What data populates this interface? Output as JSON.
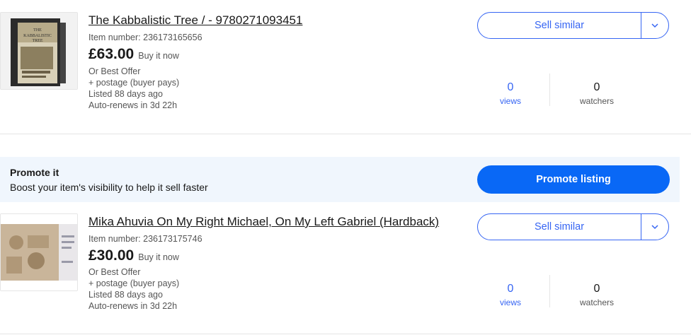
{
  "listings": [
    {
      "title": "The Kabbalistic Tree / - 9780271093451",
      "item_number": "Item number: 236173165656",
      "price": "£63.00",
      "format": "Buy it now",
      "best_offer": "Or Best Offer",
      "postage": "+ postage (buyer pays)",
      "listed": "Listed 88 days ago",
      "renews": "Auto-renews in 3d 22h",
      "sell_similar": "Sell similar",
      "views_count": "0",
      "views_label": "views",
      "watchers_count": "0",
      "watchers_label": "watchers",
      "thumbnail_text": "THE KABBALISTIC TREE"
    },
    {
      "title": "Mika Ahuvia On My Right Michael, On My Left Gabriel (Hardback)",
      "item_number": "Item number: 236173175746",
      "price": "£30.00",
      "format": "Buy it now",
      "best_offer": "Or Best Offer",
      "postage": "+ postage (buyer pays)",
      "listed": "Listed 88 days ago",
      "renews": "Auto-renews in 3d 22h",
      "sell_similar": "Sell similar",
      "views_count": "0",
      "views_label": "views",
      "watchers_count": "0",
      "watchers_label": "watchers"
    }
  ],
  "promo": {
    "title": "Promote it",
    "subtitle": "Boost your item's visibility to help it sell faster",
    "button": "Promote listing"
  },
  "colors": {
    "accent": "#3665f3",
    "promote_button": "#0968f6",
    "promo_background": "#f0f6fd"
  },
  "icons": {
    "dropdown": "chevron-down-icon"
  }
}
